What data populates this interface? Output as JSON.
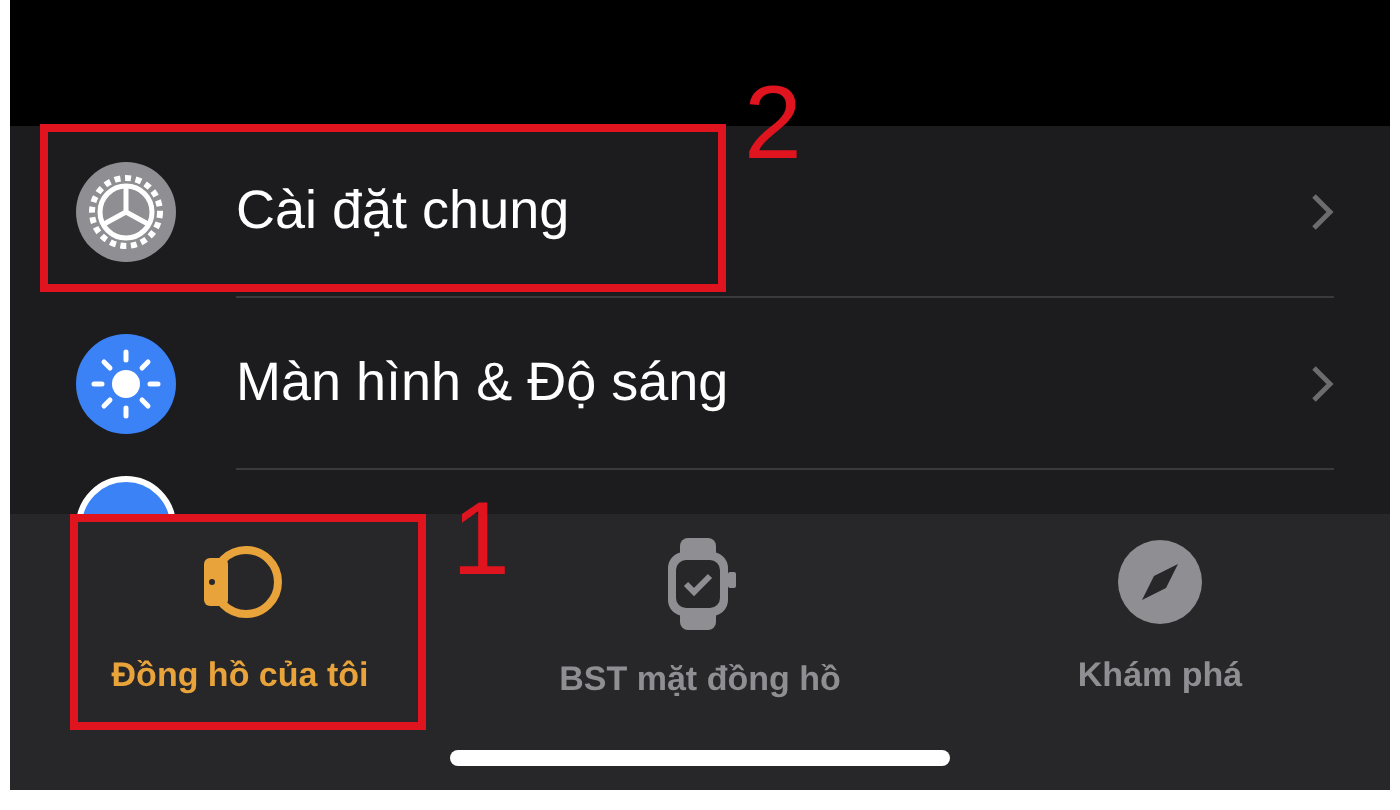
{
  "settings_rows": [
    {
      "kind": "general",
      "label": "Cài đặt chung"
    },
    {
      "kind": "display",
      "label": "Màn hình & Độ sáng"
    },
    {
      "kind": "partial"
    }
  ],
  "tabs": [
    {
      "kind": "watch-band",
      "label": "Đồng hồ của tôi",
      "selected": true
    },
    {
      "kind": "watch-face",
      "label": "BST mặt đồng hồ",
      "selected": false
    },
    {
      "kind": "compass",
      "label": "Khám phá",
      "selected": false
    }
  ],
  "annotations": [
    {
      "kind": "row",
      "label": "2"
    },
    {
      "kind": "tab",
      "label": "1"
    }
  ]
}
